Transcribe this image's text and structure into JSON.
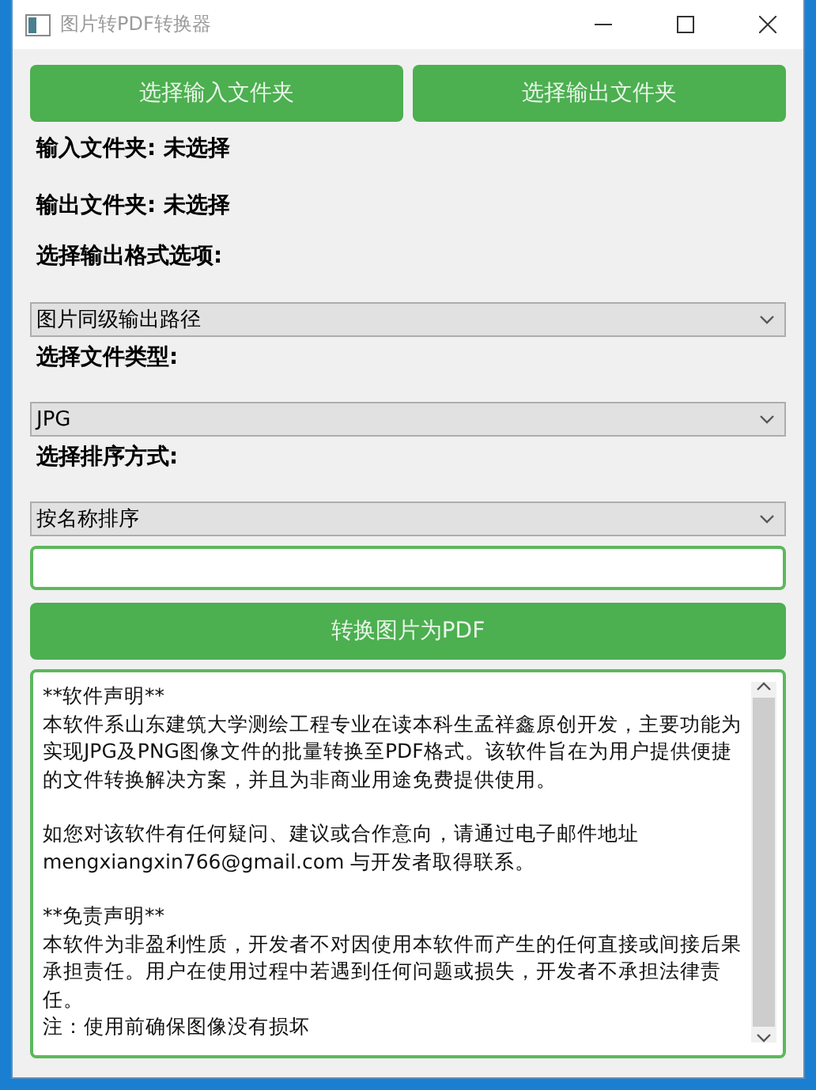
{
  "window": {
    "title": "图片转PDF转换器"
  },
  "folder_buttons": [
    "选择输入文件夹",
    "选择输出文件夹"
  ],
  "status_lines": [
    "输入文件夹: 未选择",
    "输出文件夹: 未选择"
  ],
  "options": [
    {
      "label": "选择输出格式选项:",
      "value": "图片同级输出路径"
    },
    {
      "label": "选择文件类型:",
      "value": "JPG"
    },
    {
      "label": "选择排序方式:",
      "value": "按名称排序"
    }
  ],
  "path_field": {
    "focused": true
  },
  "convert_button": "转换图片为PDF",
  "notice": {
    "blocks": [
      [
        "**软件声明**",
        "本软件系山东建筑大学测绘工程专业在读本科生孟祥鑫原创开发，主要功能为实现JPG及PNG图像文件的批量转换至PDF格式。该软件旨在为用户提供便捷的文件转换解决方案，并且为非商业用途免费提供使用。"
      ],
      [
        "如您对该软件有任何疑问、建议或合作意向，请通过电子邮件地址",
        "mengxiangxin766@gmail.com 与开发者取得联系。"
      ],
      [
        "**免责声明**",
        "本软件为非盈利性质，开发者不对因使用本软件而产生的任何直接或间接后果承担责任。用户在使用过程中若遇到任何问题或损失，开发者不承担法律责任。",
        "注：使用前确保图像没有损坏"
      ]
    ]
  }
}
